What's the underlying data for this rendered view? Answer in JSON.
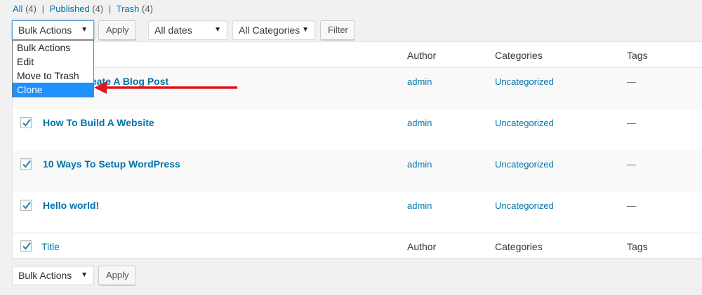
{
  "status_links": {
    "all_label": "All",
    "all_count": "(4)",
    "published_label": "Published",
    "published_count": "(4)",
    "trash_label": "Trash",
    "trash_count": "(4)",
    "separator": "|"
  },
  "top_nav": {
    "bulk_actions": {
      "selected": "Bulk Actions",
      "options": [
        "Bulk Actions",
        "Edit",
        "Move to Trash",
        "Clone"
      ],
      "highlighted": "Clone"
    },
    "apply_label": "Apply",
    "dates_selected": "All dates",
    "categories_selected": "All Categories",
    "filter_label": "Filter"
  },
  "table": {
    "columns": {
      "title": "Title",
      "author": "Author",
      "categories": "Categories",
      "tags": "Tags"
    },
    "rows": [
      {
        "title": "How To Create A Blog Post",
        "author": "admin",
        "categories": "Uncategorized",
        "tags": "—",
        "checked": true
      },
      {
        "title": "How To Build A Website",
        "author": "admin",
        "categories": "Uncategorized",
        "tags": "—",
        "checked": true
      },
      {
        "title": "10 Ways To Setup WordPress",
        "author": "admin",
        "categories": "Uncategorized",
        "tags": "—",
        "checked": true
      },
      {
        "title": "Hello world!",
        "author": "admin",
        "categories": "Uncategorized",
        "tags": "—",
        "checked": true
      }
    ]
  },
  "bottom_nav": {
    "bulk_actions_selected": "Bulk Actions",
    "apply_label": "Apply"
  },
  "colors": {
    "link": "#0073aa",
    "highlight": "#1e90ff",
    "arrow": "#e0161b",
    "background": "#f1f1f1"
  }
}
